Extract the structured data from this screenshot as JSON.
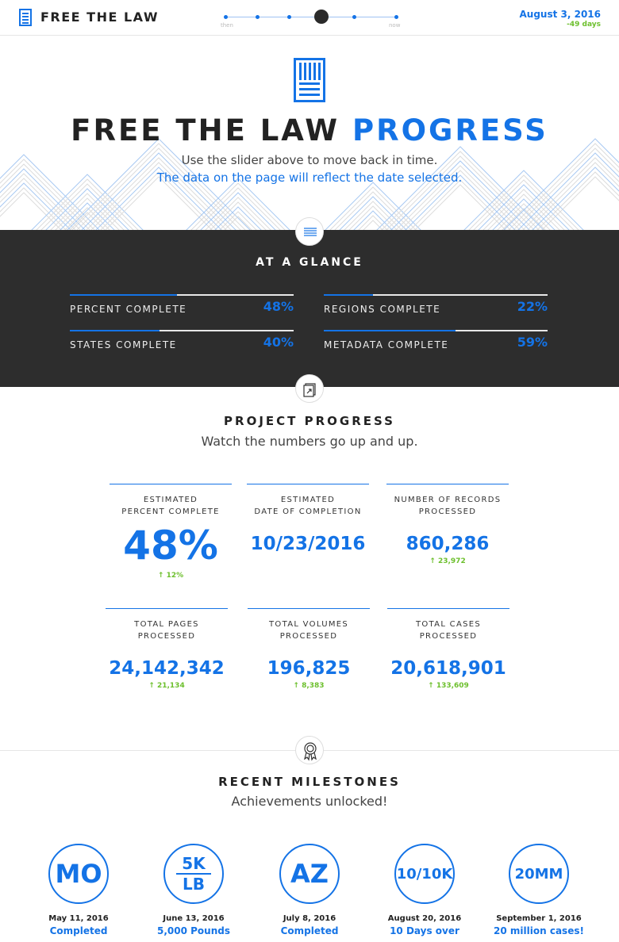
{
  "header": {
    "brand": "FREE THE LAW",
    "timeline": {
      "start_label": "then",
      "end_label": "now"
    },
    "date": "August 3, 2016",
    "days_ago": "-49 days"
  },
  "hero": {
    "title_dark": "FREE THE LAW",
    "title_blue": "PROGRESS",
    "line1": "Use the slider above to move back in time.",
    "line2": "The data on the page will reflect the date selected."
  },
  "glance": {
    "title": "AT A GLANCE",
    "metrics": [
      {
        "label": "PERCENT COMPLETE",
        "value": "48%",
        "fraction": 0.48
      },
      {
        "label": "REGIONS COMPLETE",
        "value": "22%",
        "fraction": 0.22
      },
      {
        "label": "STATES COMPLETE",
        "value": "40%",
        "fraction": 0.4
      },
      {
        "label": "METADATA COMPLETE",
        "value": "59%",
        "fraction": 0.59
      }
    ]
  },
  "progress": {
    "title": "PROJECT PROGRESS",
    "subtitle": "Watch the numbers go up and up.",
    "stats": [
      {
        "label1": "ESTIMATED",
        "label2": "PERCENT COMPLETE",
        "value": "48%",
        "delta": "↑ 12%"
      },
      {
        "label1": "ESTIMATED",
        "label2": "DATE OF COMPLETION",
        "value": "10/23/2016",
        "delta": ""
      },
      {
        "label1": "NUMBER OF RECORDS",
        "label2": "PROCESSED",
        "value": "860,286",
        "delta": "↑ 23,972"
      },
      {
        "label1": "TOTAL PAGES",
        "label2": "PROCESSED",
        "value": "24,142,342",
        "delta": "↑ 21,134"
      },
      {
        "label1": "TOTAL VOLUMES",
        "label2": "PROCESSED",
        "value": "196,825",
        "delta": "↑ 8,383"
      },
      {
        "label1": "TOTAL CASES",
        "label2": "PROCESSED",
        "value": "20,618,901",
        "delta": "↑ 133,609"
      }
    ]
  },
  "milestones": {
    "title": "RECENT MILESTONES",
    "subtitle": "Achievements unlocked!",
    "items": [
      {
        "badge": "MO",
        "date": "May 11, 2016",
        "text": "Completed"
      },
      {
        "badge_top": "5K",
        "badge_bottom": "LB",
        "date": "June 13, 2016",
        "text": "5,000 Pounds"
      },
      {
        "badge": "AZ",
        "date": "July 8, 2016",
        "text": "Completed"
      },
      {
        "badge": "10/10K",
        "date": "August 20, 2016",
        "text": "10 Days over"
      },
      {
        "badge": "20MM",
        "date": "September 1, 2016",
        "text": "20 million cases!"
      }
    ]
  },
  "colors": {
    "accent": "#1473e6",
    "positive": "#6cbf2c",
    "dark_band": "#2d2d2d"
  }
}
